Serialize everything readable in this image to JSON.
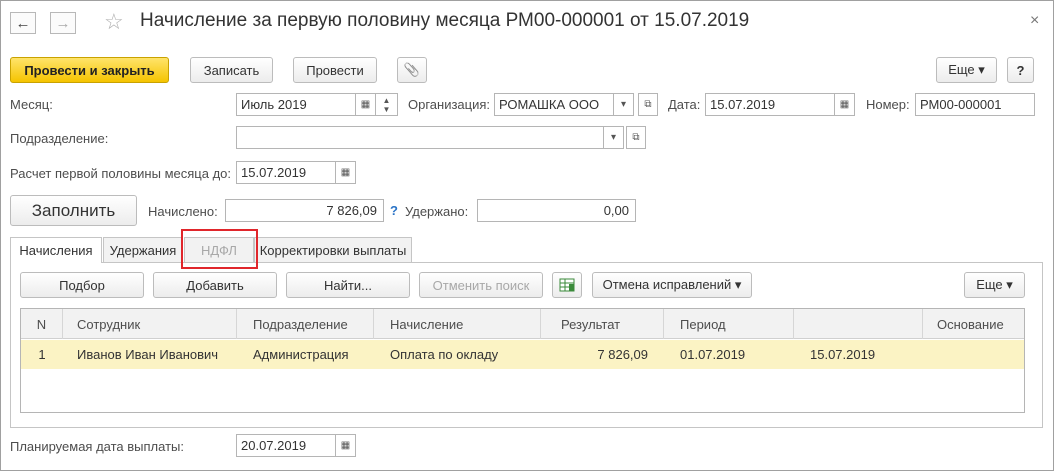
{
  "window": {
    "title": "Начисление за первую половину месяца РМ00-000001 от 15.07.2019",
    "back_glyph": "←",
    "forward_glyph": "→",
    "favorite_glyph": "☆",
    "close_glyph": "×"
  },
  "toolbar": {
    "post_close_label": "Провести и закрыть",
    "save_label": "Записать",
    "post_label": "Провести",
    "attach_glyph": "📎",
    "more_label": "Еще ▾",
    "help_label": "?"
  },
  "form": {
    "month_label": "Месяц:",
    "month_value": "Июль 2019",
    "org_label": "Организация:",
    "org_value": "РОМАШКА ООО",
    "date_label": "Дата:",
    "date_value": "15.07.2019",
    "number_label": "Номер:",
    "number_value": "РМ00-000001",
    "dept_label": "Подразделение:",
    "dept_value": "",
    "calc_until_label": "Расчет первой половины месяца до:",
    "calc_until_value": "15.07.2019",
    "fill_label": "Заполнить",
    "accrued_label": "Начислено:",
    "accrued_value": "7 826,09",
    "accrued_help": "?",
    "withheld_label": "Удержано:",
    "withheld_value": "0,00",
    "pay_date_label": "Планируемая дата выплаты:",
    "pay_date_value": "20.07.2019"
  },
  "tabs": [
    {
      "label": "Начисления"
    },
    {
      "label": "Удержания"
    },
    {
      "label": "НДФЛ"
    },
    {
      "label": "Корректировки выплаты"
    }
  ],
  "grid_toolbar": {
    "pick_label": "Подбор",
    "add_label": "Добавить",
    "find_label": "Найти...",
    "cancel_search_label": "Отменить поиск",
    "cancel_corrections_label": "Отмена исправлений ▾",
    "more_label": "Еще ▾"
  },
  "table": {
    "columns": [
      "N",
      "Сотрудник",
      "Подразделение",
      "Начисление",
      "Результат",
      "Период",
      "",
      "Основание"
    ],
    "rows": [
      [
        "1",
        "Иванов Иван Иванович",
        "Администрация",
        "Оплата по окладу",
        "7 826,09",
        "01.07.2019",
        "15.07.2019",
        ""
      ]
    ]
  },
  "colors": {
    "primary_button": "#f5c400",
    "selected_row": "#fbf3c4",
    "highlight_box": "#e0262b",
    "help_mark": "#2b74c7"
  }
}
